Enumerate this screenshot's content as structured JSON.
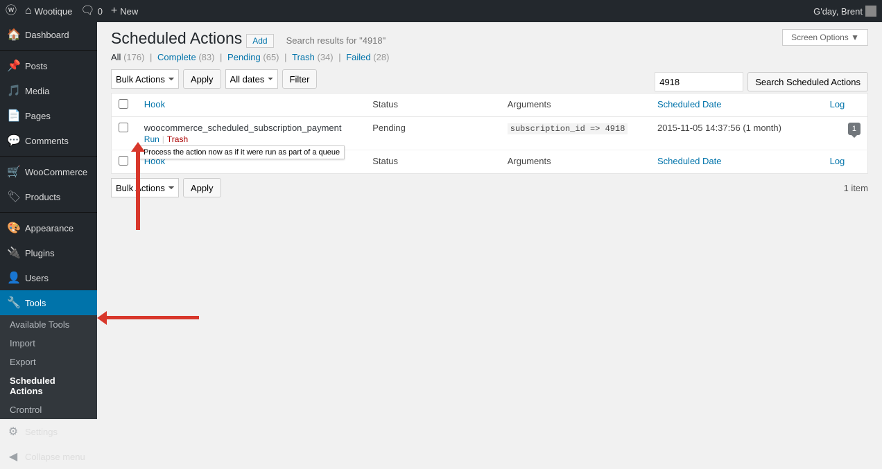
{
  "adminbar": {
    "site_name": "Wootique",
    "comments_count": "0",
    "new_label": "New",
    "greeting": "G'day, Brent"
  },
  "sidebar": {
    "items": [
      {
        "icon": "🏠",
        "label": "Dashboard",
        "name": "dashboard"
      },
      {
        "icon": "📌",
        "label": "Posts",
        "name": "posts",
        "sep": true
      },
      {
        "icon": "🎵",
        "label": "Media",
        "name": "media"
      },
      {
        "icon": "📄",
        "label": "Pages",
        "name": "pages"
      },
      {
        "icon": "💬",
        "label": "Comments",
        "name": "comments"
      },
      {
        "icon": "🛒",
        "label": "WooCommerce",
        "name": "woocommerce",
        "sep": true
      },
      {
        "icon": "🏷",
        "label": "Products",
        "name": "products"
      },
      {
        "icon": "🎨",
        "label": "Appearance",
        "name": "appearance",
        "sep": true
      },
      {
        "icon": "🔌",
        "label": "Plugins",
        "name": "plugins"
      },
      {
        "icon": "👤",
        "label": "Users",
        "name": "users"
      },
      {
        "icon": "🔧",
        "label": "Tools",
        "name": "tools",
        "current": true
      },
      {
        "icon": "⚙",
        "label": "Settings",
        "name": "settings"
      },
      {
        "icon": "◀",
        "label": "Collapse menu",
        "name": "collapse"
      }
    ],
    "tools_submenu": [
      {
        "label": "Available Tools",
        "name": "available-tools"
      },
      {
        "label": "Import",
        "name": "import"
      },
      {
        "label": "Export",
        "name": "export"
      },
      {
        "label": "Scheduled Actions",
        "name": "scheduled-actions",
        "current": true
      },
      {
        "label": "Crontrol",
        "name": "crontrol"
      }
    ]
  },
  "screen_options_label": "Screen Options ▼",
  "page": {
    "title": "Scheduled Actions",
    "add_label": "Add",
    "search_results_text": "Search results for \"4918\""
  },
  "filters": [
    {
      "label": "All",
      "count": "176",
      "current": true
    },
    {
      "label": "Complete",
      "count": "83"
    },
    {
      "label": "Pending",
      "count": "65"
    },
    {
      "label": "Trash",
      "count": "34"
    },
    {
      "label": "Failed",
      "count": "28"
    }
  ],
  "search": {
    "value": "4918",
    "button": "Search Scheduled Actions"
  },
  "bulk": {
    "select_label": "Bulk Actions",
    "apply_label": "Apply",
    "dates_label": "All dates",
    "filter_label": "Filter"
  },
  "items_count_text": "1 item",
  "columns": {
    "hook": "Hook",
    "status": "Status",
    "arguments": "Arguments",
    "scheduled_date": "Scheduled Date",
    "log": "Log"
  },
  "rows": [
    {
      "hook": "woocommerce_scheduled_subscription_payment",
      "status": "Pending",
      "args": "subscription_id => 4918",
      "date": "2015-11-05 14:37:56 (1 month)",
      "log_count": "1",
      "actions": {
        "run": "Run",
        "trash": "Trash"
      }
    }
  ],
  "tooltip_text": "Process the action now as if it were run as part of a queue"
}
